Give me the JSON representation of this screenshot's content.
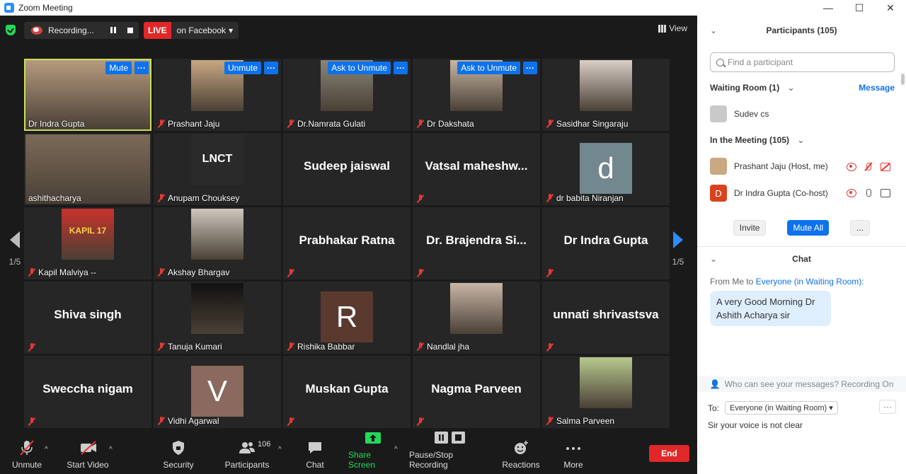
{
  "window": {
    "title": "Zoom Meeting",
    "controls": [
      "—",
      "☐",
      "✕"
    ]
  },
  "topbar": {
    "recording_label": "Recording...",
    "live_label": "LIVE",
    "live_target": "on Facebook",
    "view_label": "View"
  },
  "tiles": [
    {
      "name": "Dr Indra Gupta",
      "kind": "video",
      "muted": false,
      "active": true,
      "buttons": [
        "Mute"
      ],
      "thumb": "#b69a7e"
    },
    {
      "name": "Prashant Jaju",
      "kind": "video",
      "muted": true,
      "buttons": [
        "Unmute"
      ],
      "thumb": "#c9a882"
    },
    {
      "name": "Dr.Namrata Gulati",
      "kind": "video",
      "muted": true,
      "buttons": [
        "Ask to Unmute"
      ],
      "thumb": "#8a8578"
    },
    {
      "name": "Dr Dakshata",
      "kind": "video",
      "muted": true,
      "buttons": [
        "Ask to Unmute"
      ],
      "thumb": "#c7b7a4"
    },
    {
      "name": "Sasidhar Singaraju",
      "kind": "video",
      "muted": true,
      "buttons": [],
      "thumb": "#d9cfc6"
    },
    {
      "name": "ashithacharya",
      "kind": "video",
      "muted": false,
      "buttons": [],
      "thumb": "#7c6a58"
    },
    {
      "name": "Anupam Chouksey",
      "kind": "logo",
      "muted": true,
      "buttons": [],
      "thumb": "#222222",
      "logo": "LNCT"
    },
    {
      "name": "Sudeep jaiswal",
      "kind": "text",
      "muted": false,
      "buttons": []
    },
    {
      "name": "Vatsal  maheshw...",
      "kind": "text",
      "muted": true,
      "buttons": []
    },
    {
      "name": "dr babita Niranjan",
      "kind": "letter",
      "muted": true,
      "buttons": [],
      "letter": "d",
      "thumb": "#73878f"
    },
    {
      "name": "Kapil Malviya --",
      "kind": "video",
      "muted": true,
      "buttons": [],
      "thumb": "#c8322a",
      "jersey": "KAPIL 17"
    },
    {
      "name": "Akshay Bhargav",
      "kind": "video",
      "muted": true,
      "buttons": [],
      "thumb": "#cfc7bd"
    },
    {
      "name": "Prabhakar Ratna",
      "kind": "text",
      "muted": true,
      "buttons": []
    },
    {
      "name": "Dr. Brajendra Si...",
      "kind": "text",
      "muted": true,
      "buttons": []
    },
    {
      "name": "Dr Indra Gupta",
      "kind": "text",
      "muted": true,
      "buttons": []
    },
    {
      "name": "Shiva singh",
      "kind": "text",
      "muted": true,
      "buttons": []
    },
    {
      "name": "Tanuja Kumari",
      "kind": "video",
      "muted": true,
      "buttons": [],
      "thumb": "#111111"
    },
    {
      "name": "Rishika Babbar",
      "kind": "letter",
      "muted": true,
      "buttons": [],
      "letter": "R",
      "thumb": "#5a3a2e"
    },
    {
      "name": "Nandlal jha",
      "kind": "video",
      "muted": true,
      "buttons": [],
      "thumb": "#c8b6a6"
    },
    {
      "name": "unnati shrivastsva",
      "kind": "text",
      "muted": true,
      "buttons": []
    },
    {
      "name": "Sweccha nigam",
      "kind": "text",
      "muted": true,
      "buttons": []
    },
    {
      "name": "Vidhi Agarwal",
      "kind": "letter",
      "muted": true,
      "buttons": [],
      "letter": "V",
      "thumb": "#8a6a5e"
    },
    {
      "name": "Muskan Gupta",
      "kind": "text",
      "muted": true,
      "buttons": []
    },
    {
      "name": "Nagma Parveen",
      "kind": "text",
      "muted": true,
      "buttons": []
    },
    {
      "name": "Salma Parveen",
      "kind": "video",
      "muted": true,
      "buttons": [],
      "thumb": "#b8c98e"
    }
  ],
  "pager": {
    "left": "1/5",
    "right": "1/5"
  },
  "toolbar": {
    "unmute": "Unmute",
    "start_video": "Start Video",
    "security": "Security",
    "participants": "Participants",
    "participants_count": "106",
    "chat": "Chat",
    "share_screen": "Share Screen",
    "pause_recording": "Pause/Stop Recording",
    "reactions": "Reactions",
    "more": "More",
    "end": "End"
  },
  "panel": {
    "title": "Participants (105)",
    "search_placeholder": "Find a participant",
    "waiting_room": "Waiting Room (1)",
    "message_link": "Message",
    "waiting": [
      {
        "name": "Sudev cs"
      }
    ],
    "in_meeting": "In the Meeting (105)",
    "members": [
      {
        "name": "Prashant Jaju (Host, me)",
        "avatar_color": "#c9a882",
        "letter": ""
      },
      {
        "name": "Dr Indra Gupta (Co-host)",
        "avatar_color": "#d9431e",
        "letter": "D"
      }
    ],
    "invite": "Invite",
    "mute_all": "Mute All",
    "more": "...",
    "chat_title": "Chat",
    "chat_from": "From Me to ",
    "chat_to": "Everyone (in Waiting Room)",
    "chat_from_suffix": ":",
    "chat_message": "A very Good Morning Dr Ashith Acharya sir",
    "who_can_see": "Who can see your messages? Recording On",
    "to_label": "To:",
    "to_value": "Everyone (in Waiting Room)",
    "chat_more": "···",
    "draft": "Sir your voice is not clear"
  },
  "colors": {
    "accent": "#0e72ed",
    "live": "#e02828",
    "active_border": "#c9e05b",
    "share_green": "#23d959"
  }
}
